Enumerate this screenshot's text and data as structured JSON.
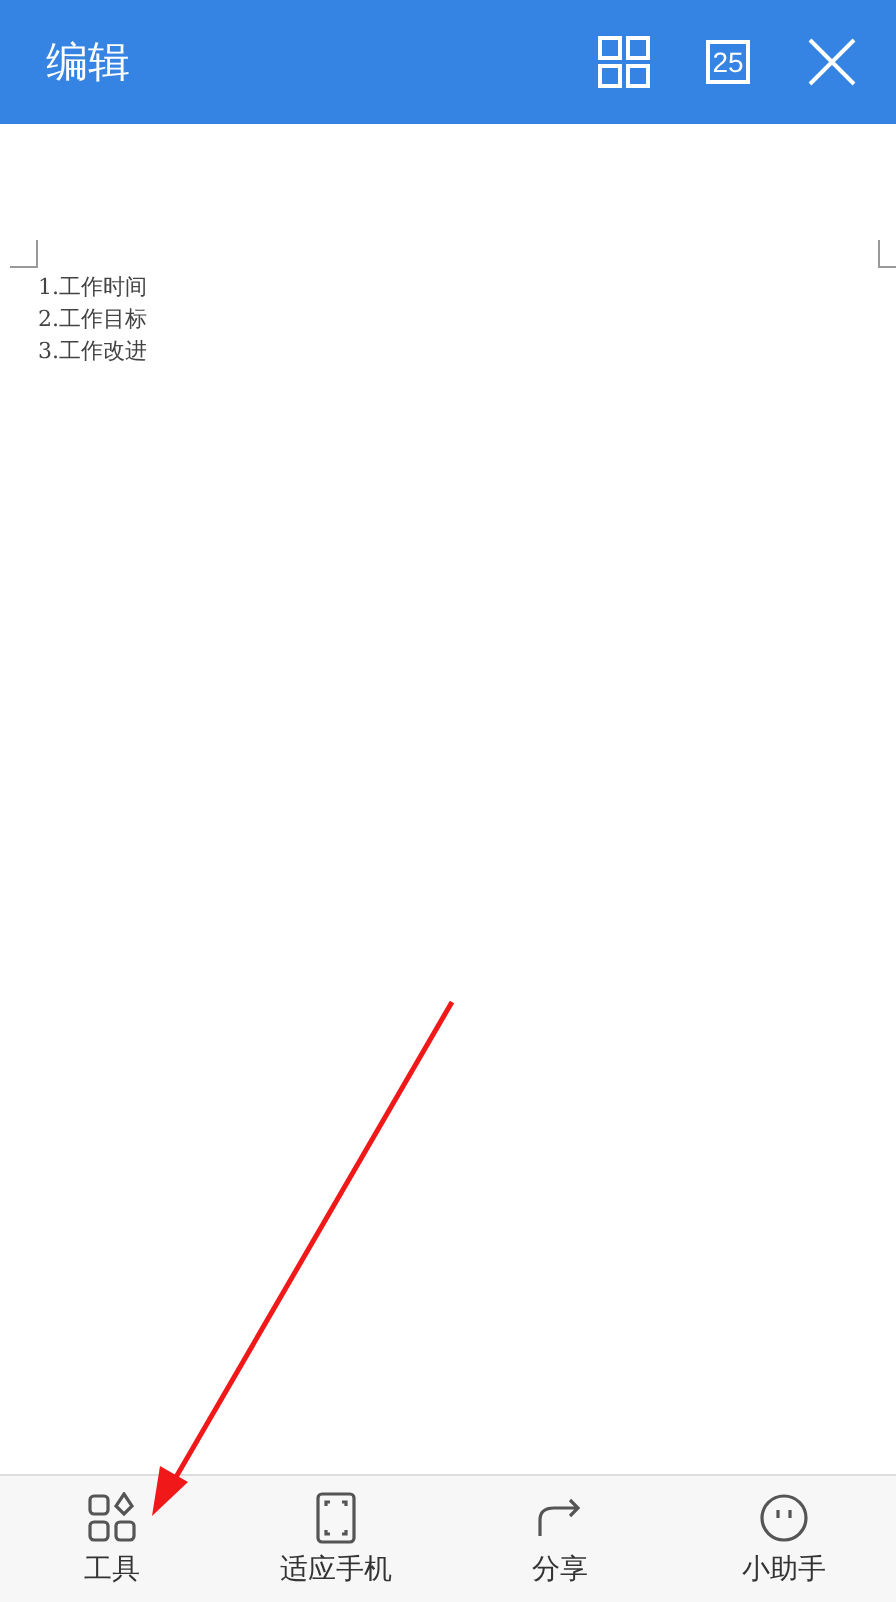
{
  "header": {
    "title": "编辑",
    "page_count": "25"
  },
  "document": {
    "lines": [
      "1.工作时间",
      "2.工作目标",
      "3.工作改进"
    ]
  },
  "toolbar": [
    {
      "kind": "tools",
      "label": "工具"
    },
    {
      "kind": "fit",
      "label": "适应手机"
    },
    {
      "kind": "share",
      "label": "分享"
    },
    {
      "kind": "assistant",
      "label": "小助手"
    }
  ]
}
